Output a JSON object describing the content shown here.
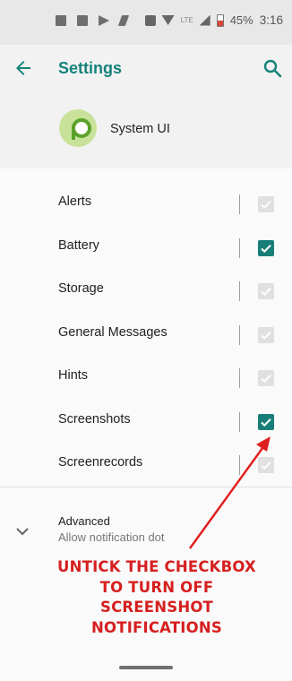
{
  "status_bar": {
    "battery": "45%",
    "time": "3:16",
    "network_label": "LTE"
  },
  "header": {
    "title": "Settings",
    "app_name": "System UI"
  },
  "notification_categories": [
    {
      "label": "Alerts",
      "checked": true,
      "disabled": true
    },
    {
      "label": "Battery",
      "checked": true,
      "disabled": false
    },
    {
      "label": "Storage",
      "checked": true,
      "disabled": true
    },
    {
      "label": "General Messages",
      "checked": true,
      "disabled": true
    },
    {
      "label": "Hints",
      "checked": true,
      "disabled": true
    },
    {
      "label": "Screenshots",
      "checked": true,
      "disabled": false
    },
    {
      "label": "Screenrecords",
      "checked": true,
      "disabled": true
    }
  ],
  "advanced": {
    "title": "Advanced",
    "subtitle": "Allow notification dot"
  },
  "annotation": {
    "lines": [
      "UNTICK THE CHECKBOX",
      "TO TURN OFF",
      "SCREENSHOT",
      "NOTIFICATIONS"
    ],
    "color": "#d61f1f"
  },
  "colors": {
    "accent": "#15837a",
    "checkbox_checked": "#187f78",
    "checkbox_disabled": "#e0e0e0"
  }
}
